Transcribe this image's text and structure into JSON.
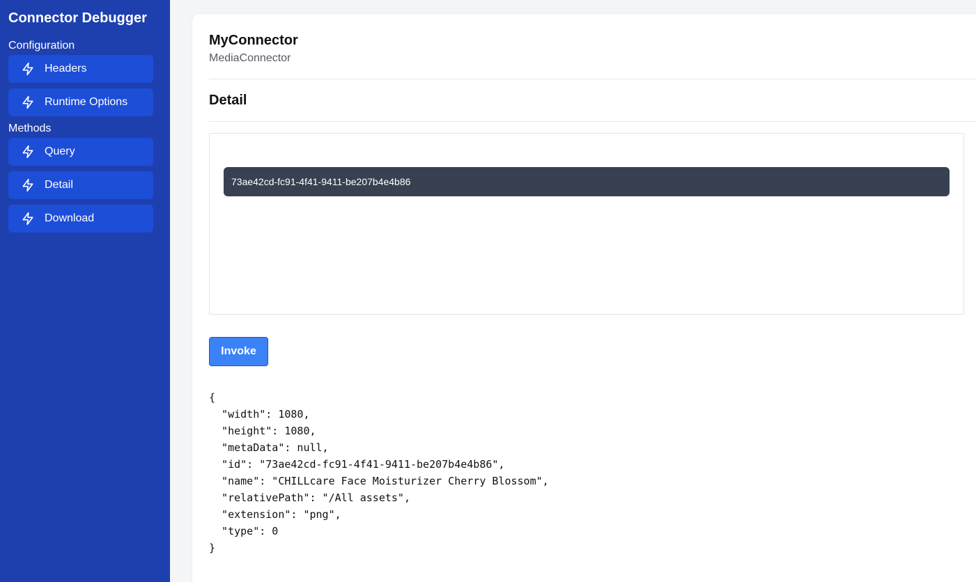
{
  "sidebar": {
    "title": "Connector Debugger",
    "sections": [
      {
        "label": "Configuration",
        "items": [
          {
            "label": "Headers",
            "icon": "bolt-icon"
          },
          {
            "label": "Runtime Options",
            "icon": "bolt-icon"
          }
        ]
      },
      {
        "label": "Methods",
        "items": [
          {
            "label": "Query",
            "icon": "bolt-icon"
          },
          {
            "label": "Detail",
            "icon": "bolt-icon"
          },
          {
            "label": "Download",
            "icon": "bolt-icon"
          }
        ]
      }
    ]
  },
  "main": {
    "connector_name": "MyConnector",
    "connector_type": "MediaConnector",
    "method_title": "Detail",
    "id_input_value": "73ae42cd-fc91-4f41-9411-be207b4e4b86",
    "invoke_label": "Invoke",
    "result_lines": [
      "{",
      "  \"width\": 1080,",
      "  \"height\": 1080,",
      "  \"metaData\": null,",
      "  \"id\": \"73ae42cd-fc91-4f41-9411-be207b4e4b86\",",
      "  \"name\": \"CHILLcare Face Moisturizer Cherry Blossom\",",
      "  \"relativePath\": \"/All assets\",",
      "  \"extension\": \"png\",",
      "  \"type\": 0",
      "}"
    ]
  },
  "colors": {
    "sidebar_bg": "#1e40af",
    "nav_item_bg": "#1d4ed8",
    "input_bg": "#374151",
    "invoke_bg": "#3b82f6"
  }
}
